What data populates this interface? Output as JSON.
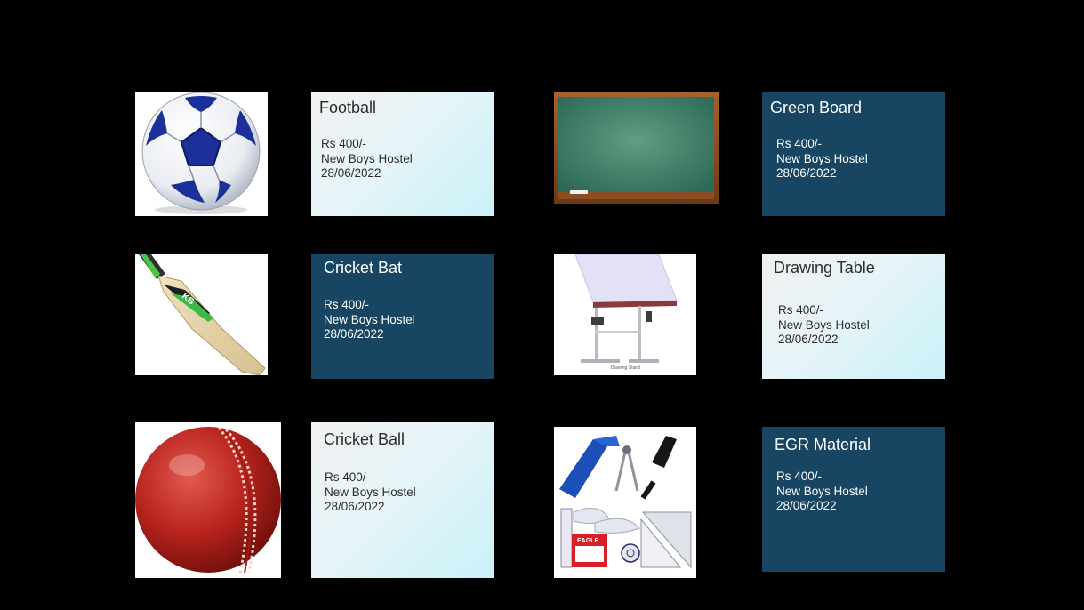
{
  "items": [
    {
      "title": "Football",
      "price": "Rs 400/-",
      "location": "New Boys Hostel",
      "date": "28/06/2022"
    },
    {
      "title": "Green Board",
      "price": "Rs 400/-",
      "location": "New Boys Hostel",
      "date": "28/06/2022"
    },
    {
      "title": "Cricket Bat",
      "price": "Rs 400/-",
      "location": "New Boys Hostel",
      "date": "28/06/2022"
    },
    {
      "title": "Drawing Table",
      "price": "Rs 400/-",
      "location": "New Boys Hostel",
      "date": "28/06/2022",
      "image_caption": "Drawing Stand"
    },
    {
      "title": "Cricket Ball",
      "price": "Rs 400/-",
      "location": "New Boys Hostel",
      "date": "28/06/2022"
    },
    {
      "title": "EGR Material",
      "price": "Rs 400/-",
      "location": "New Boys Hostel",
      "date": "28/06/2022",
      "image_caption": "EAGLE"
    }
  ],
  "colors": {
    "background": "#000000",
    "dark_card": "#174562",
    "light_card_end": "#c9f1f8"
  }
}
